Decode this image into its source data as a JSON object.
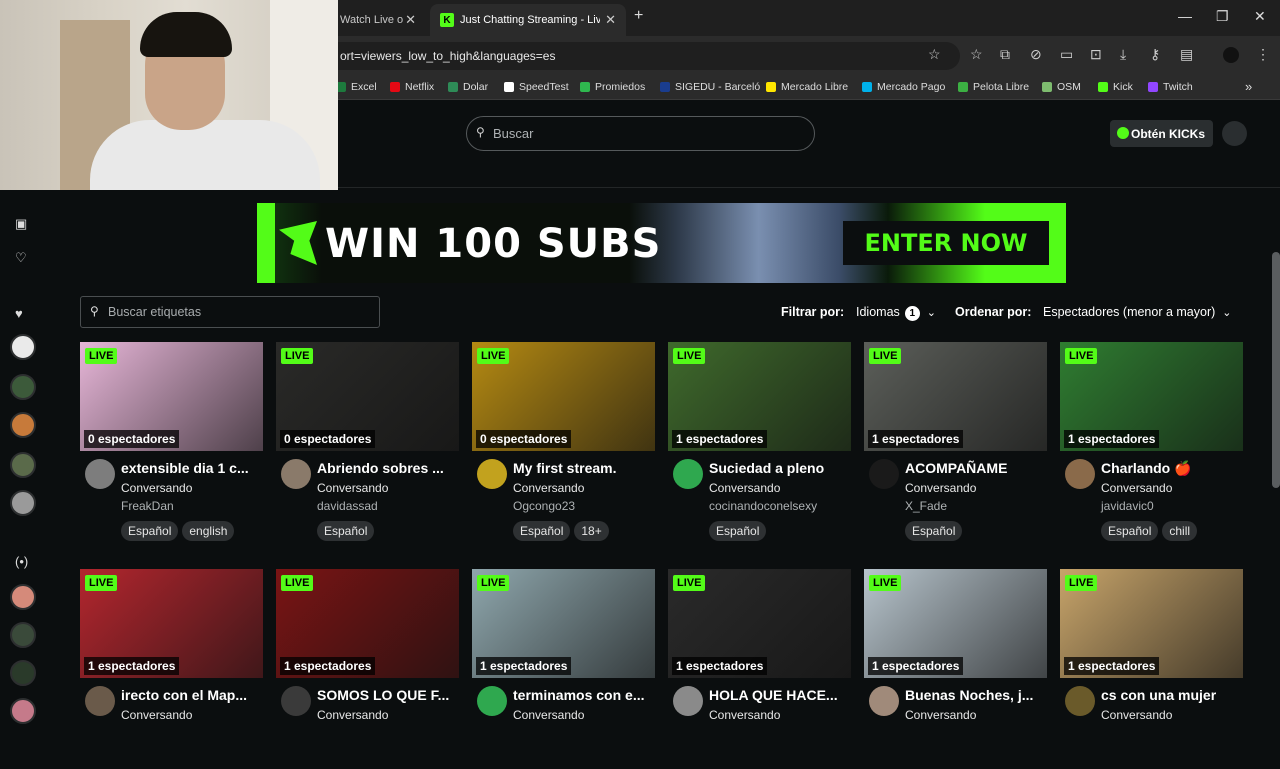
{
  "browser": {
    "tabs": [
      {
        "title": "Watch Live o",
        "active": false
      },
      {
        "title": "Just Chatting Streaming - Live S",
        "active": true
      }
    ],
    "new_tab": "+",
    "url": "ort=viewers_low_to_high&languages=es",
    "window_controls": {
      "minimize": "—",
      "restore": "❐",
      "close": "✕"
    },
    "bookmarks": [
      {
        "label": "Excel",
        "color": "#1d7a3d"
      },
      {
        "label": "Netflix",
        "color": "#e50914"
      },
      {
        "label": "Dolar",
        "color": "#2e8b57"
      },
      {
        "label": "SpeedTest",
        "color": "#ffffff"
      },
      {
        "label": "Promiedos",
        "color": "#2fb84f"
      },
      {
        "label": "SIGEDU - Barceló",
        "color": "#1a3d8f"
      },
      {
        "label": "Mercado Libre",
        "color": "#ffe600"
      },
      {
        "label": "Mercado Pago",
        "color": "#00b1ea"
      },
      {
        "label": "Pelota Libre",
        "color": "#3cb043"
      },
      {
        "label": "OSM",
        "color": "#7ebc6f"
      },
      {
        "label": "Kick",
        "color": "#53fc18"
      },
      {
        "label": "Twitch",
        "color": "#9146ff"
      }
    ],
    "bookmarks_more": "»"
  },
  "header": {
    "search_placeholder": "Buscar",
    "get_kicks": "Obtén KICKs"
  },
  "banner": {
    "title": "WIN 100 SUBS",
    "cta": "ENTER NOW"
  },
  "filters": {
    "tag_search_placeholder": "Buscar etiquetas",
    "filter_label": "Filtrar por:",
    "languages_label": "Idiomas",
    "languages_count": "1",
    "sort_label": "Ordenar por:",
    "sort_value": "Espectadores (menor a mayor)"
  },
  "colors": {
    "accent": "#53fc18",
    "background": "#0b0e0f"
  },
  "streams": [
    {
      "live": "LIVE",
      "viewers": "0 espectadores",
      "title": "extensible dia 1 c...",
      "category": "Conversando",
      "user": "FreakDan",
      "tags": [
        "Español",
        "english"
      ],
      "thumb": "#e7b6d8",
      "avatar": "#7d7d7d"
    },
    {
      "live": "LIVE",
      "viewers": "0 espectadores",
      "title": "Abriendo sobres ...",
      "category": "Conversando",
      "user": "davidassad",
      "tags": [
        "Español"
      ],
      "thumb": "#2a2a28",
      "avatar": "#8a7a6a"
    },
    {
      "live": "LIVE",
      "viewers": "0 espectadores",
      "title": "My first stream.",
      "category": "Conversando",
      "user": "Ogcongo23",
      "tags": [
        "Español",
        "18+"
      ],
      "thumb": "#b58a12",
      "avatar": "#c2a21e"
    },
    {
      "live": "LIVE",
      "viewers": "1 espectadores",
      "title": "Suciedad a pleno",
      "category": "Conversando",
      "user": "cocinandoconelsexy",
      "tags": [
        "Español"
      ],
      "thumb": "#3f6a2c",
      "avatar": "#2fa84f"
    },
    {
      "live": "LIVE",
      "viewers": "1 espectadores",
      "title": "ACOMPAÑAME",
      "category": "Conversando",
      "user": "X_Fade",
      "tags": [
        "Español"
      ],
      "thumb": "#5c5f5a",
      "avatar": "#1a1a1a"
    },
    {
      "live": "LIVE",
      "viewers": "1 espectadores",
      "title": "Charlando 🍎",
      "category": "Conversando",
      "user": "javidavic0",
      "tags": [
        "Español",
        "chill"
      ],
      "thumb": "#2f7d31",
      "avatar": "#8a6a4a"
    },
    {
      "live": "LIVE",
      "viewers": "1 espectadores",
      "title": "irecto con el Map...",
      "category": "Conversando",
      "user": "",
      "tags": [],
      "thumb": "#b3262e",
      "avatar": "#6a5a4a"
    },
    {
      "live": "LIVE",
      "viewers": "1 espectadores",
      "title": "SOMOS LO QUE F...",
      "category": "Conversando",
      "user": "",
      "tags": [],
      "thumb": "#7a1414",
      "avatar": "#3a3a3a"
    },
    {
      "live": "LIVE",
      "viewers": "1 espectadores",
      "title": "terminamos con e...",
      "category": "Conversando",
      "user": "",
      "tags": [],
      "thumb": "#8fa7ad",
      "avatar": "#2fa84f"
    },
    {
      "live": "LIVE",
      "viewers": "1 espectadores",
      "title": "HOLA QUE HACE...",
      "category": "Conversando",
      "user": "",
      "tags": [],
      "thumb": "#2a2a2a",
      "avatar": "#8a8a8a"
    },
    {
      "live": "LIVE",
      "viewers": "1 espectadores",
      "title": "Buenas Noches, j...",
      "category": "Conversando",
      "user": "",
      "tags": [],
      "thumb": "#b7c4cc",
      "avatar": "#a08a7a"
    },
    {
      "live": "LIVE",
      "viewers": "1 espectadores",
      "title": "cs con una mujer",
      "category": "Conversando",
      "user": "",
      "tags": [],
      "thumb": "#c7a46a",
      "avatar": "#6a5a2a"
    }
  ]
}
